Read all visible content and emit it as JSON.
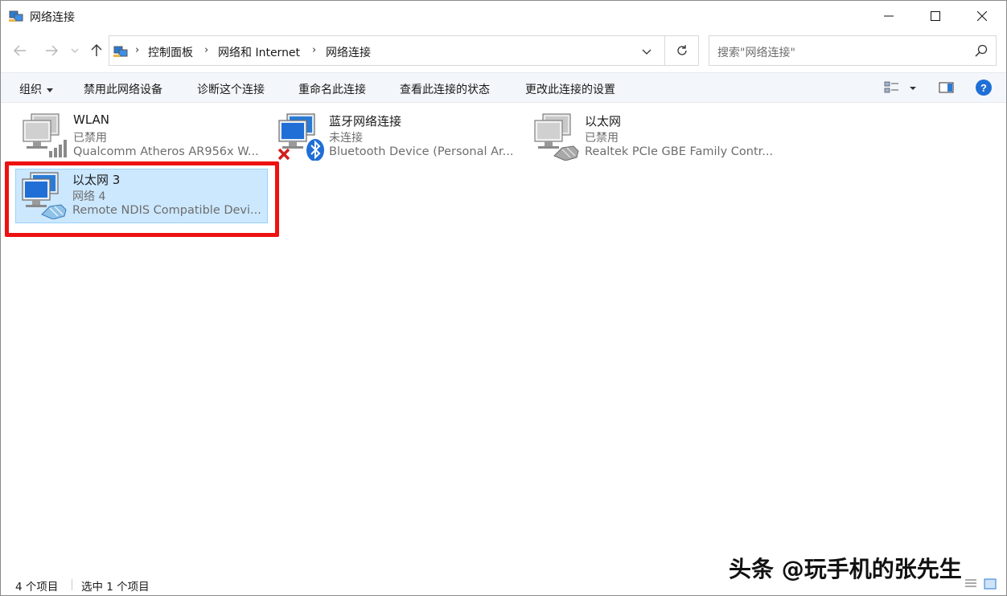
{
  "window": {
    "title": "网络连接"
  },
  "nav": {
    "breadcrumbs": [
      "控制面板",
      "网络和 Internet",
      "网络连接"
    ],
    "search_placeholder": "搜索\"网络连接\""
  },
  "commands": {
    "organize": "组织",
    "disable": "禁用此网络设备",
    "diagnose": "诊断这个连接",
    "rename": "重命名此连接",
    "view_status": "查看此连接的状态",
    "change_settings": "更改此连接的设置"
  },
  "items": [
    {
      "name": "WLAN",
      "status": "已禁用",
      "device": "Qualcomm Atheros AR956x W...",
      "icon": "wifi-adapter-icon"
    },
    {
      "name": "蓝牙网络连接",
      "status": "未连接",
      "device": "Bluetooth Device (Personal Ar...",
      "icon": "bluetooth-adapter-icon"
    },
    {
      "name": "以太网",
      "status": "已禁用",
      "device": "Realtek PCIe GBE Family Contr...",
      "icon": "ethernet-adapter-icon"
    },
    {
      "name": "以太网 3",
      "status": "网络 4",
      "device": "Remote NDIS Compatible Devi...",
      "icon": "ethernet-adapter-icon",
      "selected": true
    }
  ],
  "statusbar": {
    "count": "4 个项目",
    "selected": "选中 1 个项目"
  },
  "watermark": "头条 @玩手机的张先生",
  "colors": {
    "selection": "#cce8ff",
    "highlight_box": "#ee1111",
    "help": "#1f6fd6"
  }
}
